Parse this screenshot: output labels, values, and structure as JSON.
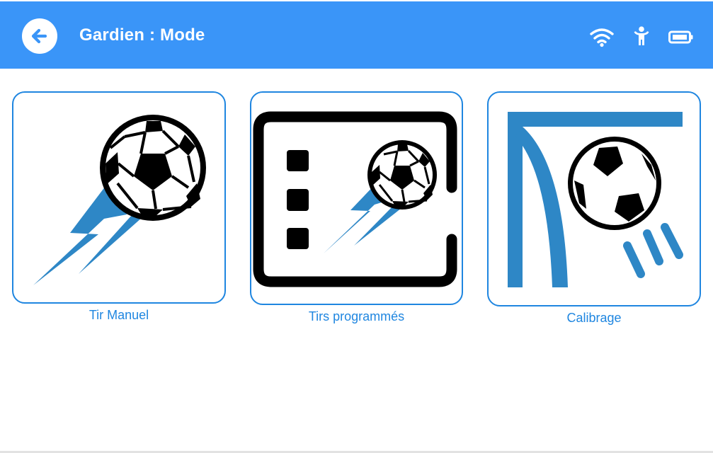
{
  "header": {
    "title": "Gardien : Mode",
    "back_icon": "arrow-left-icon",
    "status_icons": [
      "wifi-icon",
      "person-icon",
      "battery-icon"
    ],
    "color": "#3a95f8"
  },
  "modes": [
    {
      "label": "Tir Manuel",
      "icon": "soccer-ball-kick-icon"
    },
    {
      "label": "Tirs programmés",
      "icon": "programmed-shots-icon"
    },
    {
      "label": "Calibrage",
      "icon": "goal-calibration-icon"
    }
  ],
  "colors": {
    "accent": "#1f86e0",
    "icon_blue": "#2e87c6",
    "icon_black": "#000000"
  }
}
